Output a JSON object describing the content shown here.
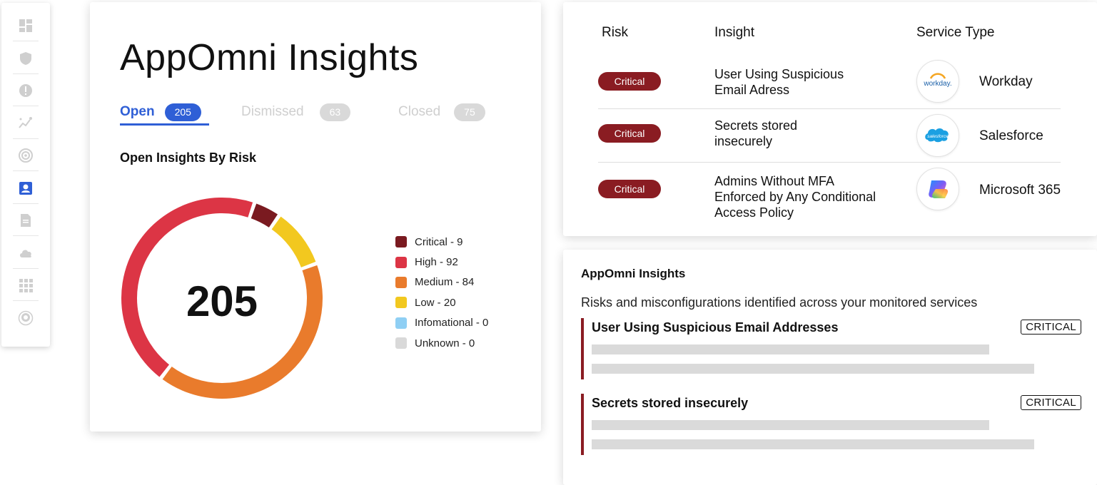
{
  "sidebar": {
    "icons": [
      "dashboard-icon",
      "shield-icon",
      "alert-icon",
      "analytics-icon",
      "signal-icon",
      "user-card-icon",
      "document-icon",
      "cloud-icon",
      "apps-grid-icon",
      "monitor-icon"
    ],
    "active_index": 5
  },
  "insights_card": {
    "title": "AppOmni Insights",
    "tabs": [
      {
        "label": "Open",
        "count": "205"
      },
      {
        "label": "Dismissed",
        "count": "63"
      },
      {
        "label": "Closed",
        "count": "75"
      }
    ],
    "section_title": "Open Insights By Risk",
    "total": "205"
  },
  "chart_data": {
    "type": "pie",
    "title": "Open Insights By Risk",
    "center_label": "205",
    "categories": [
      "Critical",
      "High",
      "Medium",
      "Low",
      "Infomational",
      "Unknown"
    ],
    "values": [
      9,
      92,
      84,
      20,
      0,
      0
    ],
    "legend": [
      "Critical - 9",
      "High - 92",
      "Medium - 84",
      "Low - 20",
      "Infomational - 0",
      "Unknown - 0"
    ],
    "colors": [
      "#7a1a20",
      "#dc3545",
      "#e97b2c",
      "#f2c81f",
      "#8fcff4",
      "#d9d9d9"
    ],
    "legend_placement": "right"
  },
  "table": {
    "headers": {
      "risk": "Risk",
      "insight": "Insight",
      "service": "Service Type"
    },
    "rows": [
      {
        "risk": "Critical",
        "insight_lines": [
          "User Using Suspicious",
          "Email Adress"
        ],
        "logo": "workday",
        "logo_text": "workday.",
        "service": "Workday"
      },
      {
        "risk": "Critical",
        "insight_lines": [
          "Secrets stored",
          "insecurely"
        ],
        "logo": "salesforce",
        "logo_text": "salesforce",
        "service": "Salesforce"
      },
      {
        "risk": "Critical",
        "insight_lines": [
          "Admins Without MFA",
          "Enforced by Any Conditional",
          "Access Policy"
        ],
        "logo": "microsoft365",
        "service": "Microsoft 365"
      }
    ]
  },
  "detail_card": {
    "title": "AppOmni Insights",
    "description": "Risks and misconfigurations identified across your monitored services",
    "items": [
      {
        "title": "User Using Suspicious Email Addresses",
        "tag": "CRITICAL"
      },
      {
        "title": "Secrets stored insecurely",
        "tag": "CRITICAL"
      }
    ]
  },
  "colors": {
    "accent": "#2f5fd6",
    "critical": "#8a1c22"
  }
}
